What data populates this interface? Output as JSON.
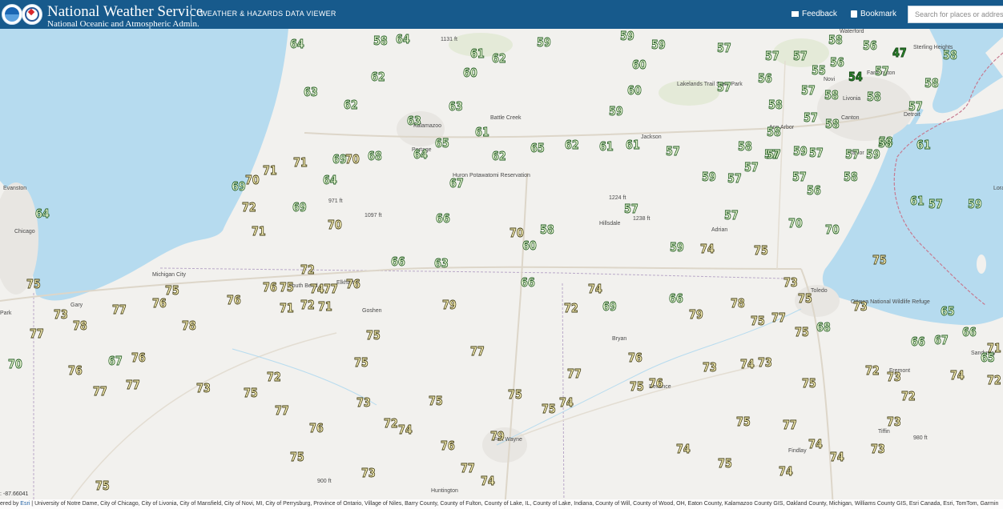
{
  "header": {
    "agency_name": "National Weather Service",
    "agency_subtitle": "National Oceanic and Atmospheric Admin.",
    "app_title": "WEATHER & HAZARDS DATA VIEWER",
    "feedback_label": "Feedback",
    "bookmark_label": "Bookmark",
    "search_placeholder": "Search for places or addresses",
    "colors": {
      "bar": "#175a8c"
    }
  },
  "map": {
    "colors": {
      "land": "#f2f1ee",
      "water": "#b6dbef",
      "temp_green": "#2e8b2e",
      "temp_yellow": "#fff6bc"
    },
    "places": [
      {
        "name": "Waterford"
      },
      {
        "name": "Sterling Heights"
      },
      {
        "name": "Farmington"
      },
      {
        "name": "Novi"
      },
      {
        "name": "Livonia"
      },
      {
        "name": "Canton"
      },
      {
        "name": "Detroit"
      },
      {
        "name": "Taylor"
      },
      {
        "name": "Ann Arbor"
      },
      {
        "name": "Jackson"
      },
      {
        "name": "Battle Creek"
      },
      {
        "name": "Kalamazoo"
      },
      {
        "name": "Portage"
      },
      {
        "name": "Lakelands Trail State Park"
      },
      {
        "name": "Huron Potawatomi Reservation"
      },
      {
        "name": "Hillsdale"
      },
      {
        "name": "Adrian"
      },
      {
        "name": "Evanston"
      },
      {
        "name": "Chicago"
      },
      {
        "name": "Michigan City"
      },
      {
        "name": "South Bend"
      },
      {
        "name": "Elkhart"
      },
      {
        "name": "Goshen"
      },
      {
        "name": "Gary"
      },
      {
        "name": "Park"
      },
      {
        "name": "Toledo"
      },
      {
        "name": "Ottawa National Wildlife Refuge"
      },
      {
        "name": "Sandusky"
      },
      {
        "name": "Fremont"
      },
      {
        "name": "Tiffin"
      },
      {
        "name": "Findlay"
      },
      {
        "name": "Bryan"
      },
      {
        "name": "Defiance"
      },
      {
        "name": "Fort Wayne"
      },
      {
        "name": "Huntington"
      },
      {
        "name": "Lorain"
      },
      {
        "name": "1131 ft"
      },
      {
        "name": "1224 ft"
      },
      {
        "name": "1238 ft"
      },
      {
        "name": "971 ft"
      },
      {
        "name": "1097 ft"
      },
      {
        "name": "980 ft"
      },
      {
        "name": "900 ft"
      }
    ],
    "temperatures": [
      {
        "v": "64",
        "c": "g"
      },
      {
        "v": "58",
        "c": "g"
      },
      {
        "v": "64",
        "c": "g"
      },
      {
        "v": "61",
        "c": "g"
      },
      {
        "v": "62",
        "c": "g"
      },
      {
        "v": "60",
        "c": "g"
      },
      {
        "v": "59",
        "c": "g"
      },
      {
        "v": "59",
        "c": "g"
      },
      {
        "v": "59",
        "c": "g"
      },
      {
        "v": "60",
        "c": "g"
      },
      {
        "v": "57",
        "c": "g"
      },
      {
        "v": "57",
        "c": "g"
      },
      {
        "v": "57",
        "c": "g"
      },
      {
        "v": "58",
        "c": "g"
      },
      {
        "v": "56",
        "c": "g"
      },
      {
        "v": "56",
        "c": "g"
      },
      {
        "v": "55",
        "c": "g"
      },
      {
        "v": "47",
        "c": "dg"
      },
      {
        "v": "58",
        "c": "g"
      },
      {
        "v": "54",
        "c": "dg"
      },
      {
        "v": "57",
        "c": "g"
      },
      {
        "v": "58",
        "c": "g"
      },
      {
        "v": "56",
        "c": "g"
      },
      {
        "v": "57",
        "c": "g"
      },
      {
        "v": "57",
        "c": "g"
      },
      {
        "v": "58",
        "c": "g"
      },
      {
        "v": "58",
        "c": "g"
      },
      {
        "v": "57",
        "c": "g"
      },
      {
        "v": "58",
        "c": "g"
      },
      {
        "v": "63",
        "c": "g"
      },
      {
        "v": "62",
        "c": "g"
      },
      {
        "v": "62",
        "c": "g"
      },
      {
        "v": "63",
        "c": "g"
      },
      {
        "v": "63",
        "c": "g"
      },
      {
        "v": "60",
        "c": "g"
      },
      {
        "v": "59",
        "c": "g"
      },
      {
        "v": "58",
        "c": "g"
      },
      {
        "v": "57",
        "c": "g"
      },
      {
        "v": "58",
        "c": "g"
      },
      {
        "v": "57",
        "c": "g"
      },
      {
        "v": "61",
        "c": "g"
      },
      {
        "v": "65",
        "c": "g"
      },
      {
        "v": "62",
        "c": "g"
      },
      {
        "v": "65",
        "c": "g"
      },
      {
        "v": "62",
        "c": "g"
      },
      {
        "v": "61",
        "c": "g"
      },
      {
        "v": "61",
        "c": "g"
      },
      {
        "v": "57",
        "c": "g"
      },
      {
        "v": "58",
        "c": "g"
      },
      {
        "v": "57",
        "c": "g"
      },
      {
        "v": "59",
        "c": "g"
      },
      {
        "v": "57",
        "c": "g"
      },
      {
        "v": "57",
        "c": "g"
      },
      {
        "v": "59",
        "c": "g"
      },
      {
        "v": "58",
        "c": "g"
      },
      {
        "v": "61",
        "c": "g"
      },
      {
        "v": "71",
        "c": "y"
      },
      {
        "v": "71",
        "c": "y"
      },
      {
        "v": "69",
        "c": "g"
      },
      {
        "v": "70",
        "c": "y"
      },
      {
        "v": "68",
        "c": "g"
      },
      {
        "v": "64",
        "c": "g"
      },
      {
        "v": "67",
        "c": "g"
      },
      {
        "v": "69",
        "c": "g"
      },
      {
        "v": "70",
        "c": "y"
      },
      {
        "v": "64",
        "c": "g"
      },
      {
        "v": "64",
        "c": "g"
      },
      {
        "v": "59",
        "c": "g"
      },
      {
        "v": "57",
        "c": "g"
      },
      {
        "v": "57",
        "c": "g"
      },
      {
        "v": "56",
        "c": "g"
      },
      {
        "v": "57",
        "c": "g"
      },
      {
        "v": "58",
        "c": "g"
      },
      {
        "v": "58",
        "c": "g"
      },
      {
        "v": "57",
        "c": "g"
      },
      {
        "v": "61",
        "c": "g"
      },
      {
        "v": "59",
        "c": "g"
      },
      {
        "v": "57",
        "c": "g"
      },
      {
        "v": "57",
        "c": "g"
      },
      {
        "v": "70",
        "c": "g"
      },
      {
        "v": "70",
        "c": "g"
      },
      {
        "v": "72",
        "c": "y"
      },
      {
        "v": "69",
        "c": "g"
      },
      {
        "v": "71",
        "c": "y"
      },
      {
        "v": "70",
        "c": "y"
      },
      {
        "v": "66",
        "c": "g"
      },
      {
        "v": "70",
        "c": "y"
      },
      {
        "v": "58",
        "c": "g"
      },
      {
        "v": "60",
        "c": "g"
      },
      {
        "v": "59",
        "c": "g"
      },
      {
        "v": "74",
        "c": "y"
      },
      {
        "v": "75",
        "c": "y"
      },
      {
        "v": "75",
        "c": "y"
      },
      {
        "v": "72",
        "c": "y"
      },
      {
        "v": "66",
        "c": "g"
      },
      {
        "v": "63",
        "c": "g"
      },
      {
        "v": "66",
        "c": "g"
      },
      {
        "v": "74",
        "c": "y"
      },
      {
        "v": "73",
        "c": "y"
      },
      {
        "v": "75",
        "c": "y"
      },
      {
        "v": "75",
        "c": "y"
      },
      {
        "v": "75",
        "c": "y"
      },
      {
        "v": "76",
        "c": "y"
      },
      {
        "v": "76",
        "c": "y"
      },
      {
        "v": "75",
        "c": "y"
      },
      {
        "v": "74",
        "c": "y"
      },
      {
        "v": "77",
        "c": "y"
      },
      {
        "v": "76",
        "c": "y"
      },
      {
        "v": "76",
        "c": "y"
      },
      {
        "v": "71",
        "c": "y"
      },
      {
        "v": "72",
        "c": "y"
      },
      {
        "v": "71",
        "c": "y"
      },
      {
        "v": "79",
        "c": "y"
      },
      {
        "v": "72",
        "c": "y"
      },
      {
        "v": "69",
        "c": "g"
      },
      {
        "v": "66",
        "c": "g"
      },
      {
        "v": "79",
        "c": "y"
      },
      {
        "v": "78",
        "c": "y"
      },
      {
        "v": "75",
        "c": "y"
      },
      {
        "v": "77",
        "c": "y"
      },
      {
        "v": "75",
        "c": "y"
      },
      {
        "v": "73",
        "c": "y"
      },
      {
        "v": "68",
        "c": "g"
      },
      {
        "v": "65",
        "c": "g"
      },
      {
        "v": "66",
        "c": "g"
      },
      {
        "v": "66",
        "c": "g"
      },
      {
        "v": "67",
        "c": "g"
      },
      {
        "v": "65",
        "c": "g"
      },
      {
        "v": "71",
        "c": "y"
      },
      {
        "v": "70",
        "c": "g"
      },
      {
        "v": "67",
        "c": "g"
      },
      {
        "v": "76",
        "c": "y"
      },
      {
        "v": "76",
        "c": "y"
      },
      {
        "v": "77",
        "c": "y"
      },
      {
        "v": "77",
        "c": "y"
      },
      {
        "v": "76",
        "c": "y"
      },
      {
        "v": "76",
        "c": "y"
      },
      {
        "v": "73",
        "c": "y"
      },
      {
        "v": "74",
        "c": "y"
      },
      {
        "v": "73",
        "c": "y"
      },
      {
        "v": "72",
        "c": "y"
      },
      {
        "v": "73",
        "c": "y"
      },
      {
        "v": "72",
        "c": "y"
      },
      {
        "v": "74",
        "c": "y"
      },
      {
        "v": "72",
        "c": "y"
      },
      {
        "v": "72",
        "c": "y"
      },
      {
        "v": "75",
        "c": "y"
      },
      {
        "v": "73",
        "c": "y"
      },
      {
        "v": "73",
        "c": "y"
      },
      {
        "v": "77",
        "c": "y"
      },
      {
        "v": "78",
        "c": "y"
      },
      {
        "v": "77",
        "c": "y"
      },
      {
        "v": "78",
        "c": "y"
      },
      {
        "v": "75",
        "c": "y"
      },
      {
        "v": "75",
        "c": "y"
      },
      {
        "v": "77",
        "c": "y"
      },
      {
        "v": "77",
        "c": "y"
      },
      {
        "v": "75",
        "c": "y"
      },
      {
        "v": "75",
        "c": "y"
      },
      {
        "v": "75",
        "c": "y"
      },
      {
        "v": "74",
        "c": "y"
      },
      {
        "v": "73",
        "c": "y"
      },
      {
        "v": "72",
        "c": "y"
      },
      {
        "v": "75",
        "c": "y"
      },
      {
        "v": "74",
        "c": "y"
      },
      {
        "v": "76",
        "c": "y"
      },
      {
        "v": "79",
        "c": "y"
      },
      {
        "v": "75",
        "c": "y"
      },
      {
        "v": "77",
        "c": "y"
      },
      {
        "v": "75",
        "c": "y"
      },
      {
        "v": "77",
        "c": "y"
      },
      {
        "v": "76",
        "c": "y"
      },
      {
        "v": "74",
        "c": "y"
      },
      {
        "v": "75",
        "c": "y"
      },
      {
        "v": "74",
        "c": "y"
      },
      {
        "v": "74",
        "c": "y"
      },
      {
        "v": "73",
        "c": "y"
      },
      {
        "v": "73",
        "c": "y"
      },
      {
        "v": "75",
        "c": "y"
      },
      {
        "v": "77",
        "c": "y"
      },
      {
        "v": "74",
        "c": "y"
      },
      {
        "v": "73",
        "c": "y"
      },
      {
        "v": "75",
        "c": "y"
      },
      {
        "v": "74",
        "c": "y"
      }
    ]
  },
  "coordinates_readout": ": -87.66041",
  "attribution": {
    "prefix": "ered by ",
    "esri": "Esri",
    "text": " | University of Notre Dame, City of Chicago, City of Livonia, City of Mansfield, City of Novi, MI, City of Perrysburg, Province of Ontario, Village of Niles, Barry County, County of Fulton, County of Lake, IL, County of Lake, Indiana, County of Will, County of Wood, OH, Eaton County, Kalamazoo County GIS, Oakland County, Michigan, Williams County GIS, Esri Canada, Esri, TomTom, Garmin"
  }
}
